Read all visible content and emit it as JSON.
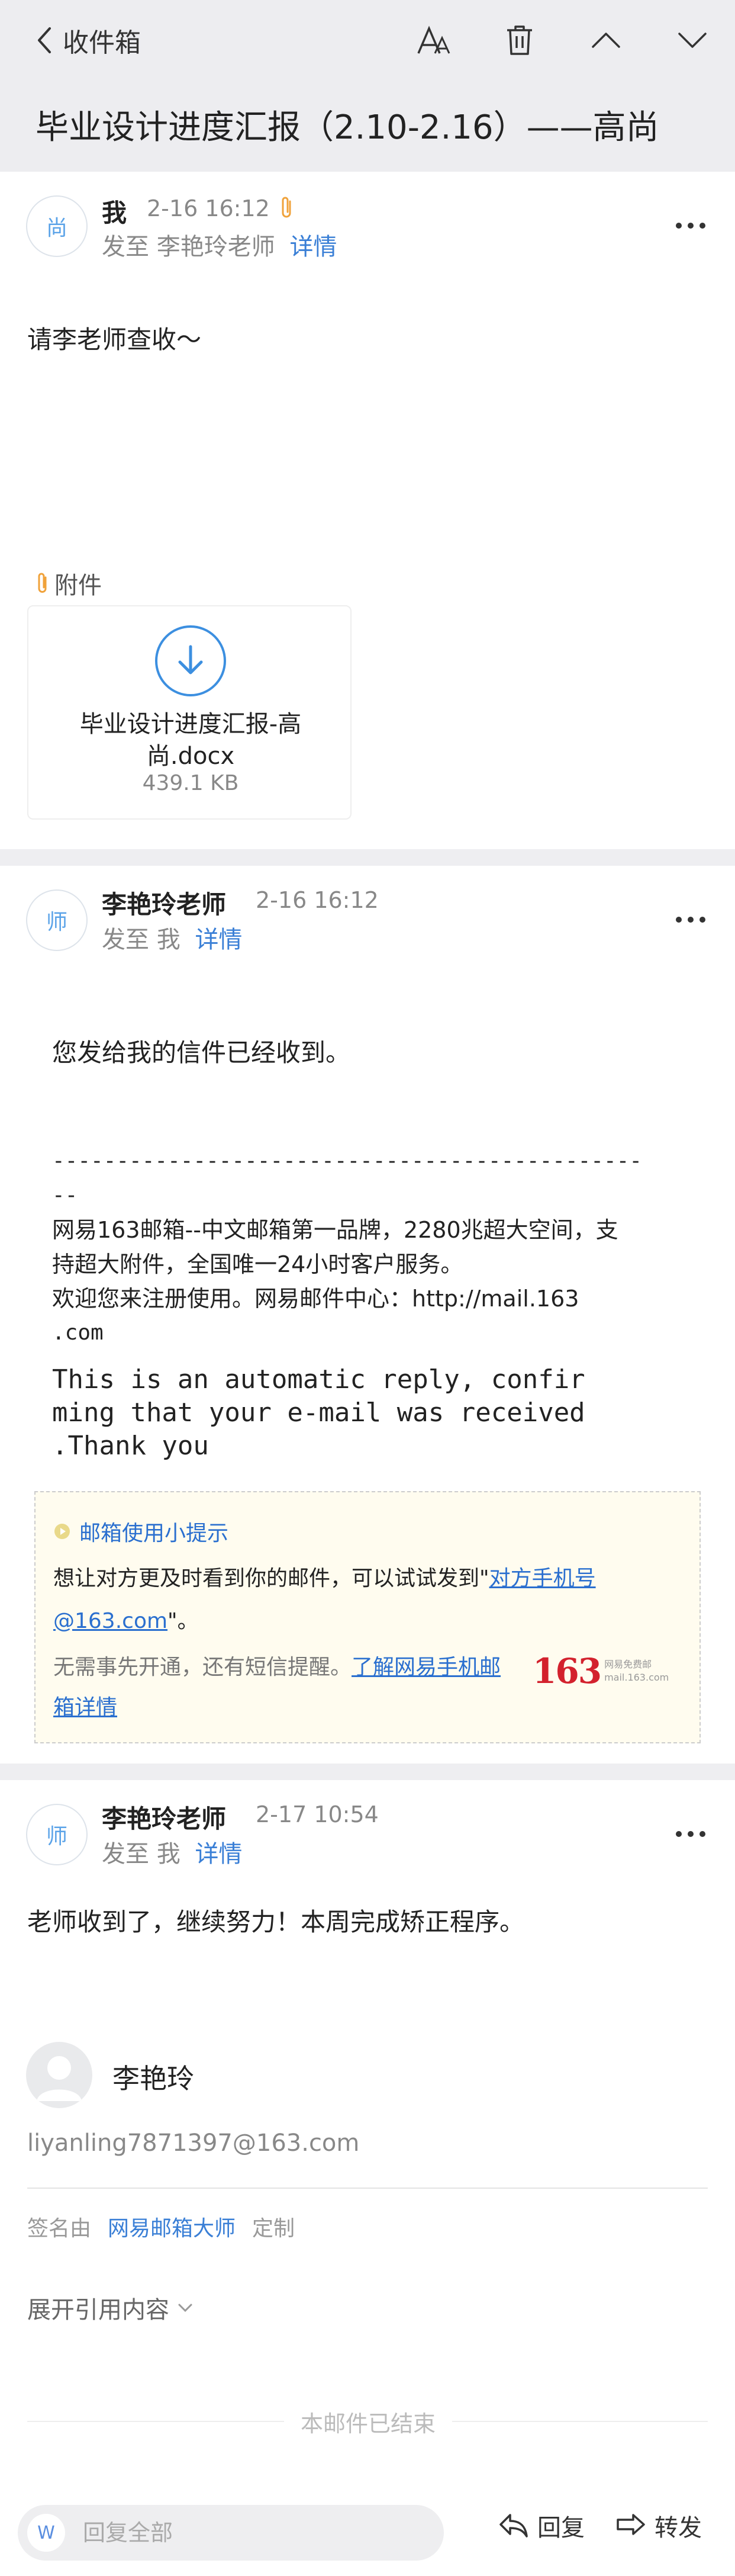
{
  "nav": {
    "back_label": "收件箱"
  },
  "subject": "毕业设计进度汇报（2.10-2.16）——高尚",
  "mail1": {
    "avatar": "尚",
    "sender": "我",
    "time": "2-16 16:12",
    "to_prefix": "发至",
    "to": "李艳玲老师",
    "details": "详情",
    "body": "请李老师查收～",
    "attachment_label": "附件",
    "attachment": {
      "name": "毕业设计进度汇报-高尚.docx",
      "size": "439.1 KB"
    }
  },
  "mail2": {
    "avatar": "师",
    "sender": "李艳玲老师",
    "time": "2-16 16:12",
    "to_prefix": "发至",
    "to": "我",
    "details": "详情",
    "body": "您发给我的信件已经收到。",
    "dash_line1": "----------------------------------------------",
    "dash_line2": "--",
    "footer1": "网易163邮箱--中文邮箱第一品牌，2280兆超大空间，支",
    "footer2": "持超大附件，全国唯一24小时客户服务。",
    "footer3": "欢迎您来注册使用。网易邮件中心：http://mail.163",
    "footer4": ".com",
    "auto1": "This is an automatic reply, confir",
    "auto2": "ming that your e-mail was received",
    "auto3": ".Thank you",
    "tip": {
      "title": "邮箱使用小提示",
      "text_pre": "想让对方更及时看到你的邮件，可以试试发到\"",
      "link1": "对方手机号@163.com",
      "text_post": "\"。",
      "sub_pre": "无需事先开通，还有短信提醒。",
      "link2": "了解网易手机邮箱详情",
      "logo_num": "163",
      "logo_line1": "网易免费邮",
      "logo_line2": "mail.163.com"
    }
  },
  "mail3": {
    "avatar": "师",
    "sender": "李艳玲老师",
    "time": "2-17 10:54",
    "to_prefix": "发至",
    "to": "我",
    "details": "详情",
    "body": "老师收到了，继续努力！本周完成矫正程序。",
    "signature": {
      "name": "李艳玲",
      "email": "liyanling7871397@163.com",
      "by_label": "签名由",
      "by_link": "网易邮箱大师",
      "customize": "定制"
    },
    "expand_label": "展开引用内容",
    "end_label": "本邮件已结束"
  },
  "bottom": {
    "avatar_letter": "W",
    "reply_placeholder": "回复全部",
    "reply_label": "回复",
    "forward_label": "转发"
  }
}
